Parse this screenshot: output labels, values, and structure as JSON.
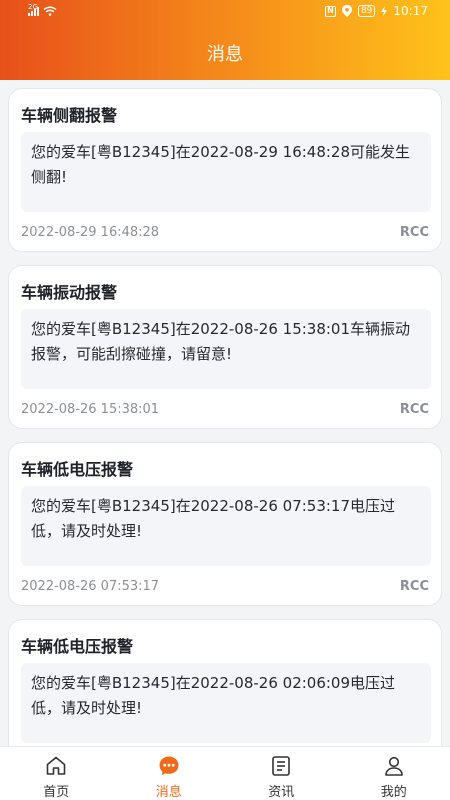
{
  "status_bar": {
    "network": "2G",
    "battery": "89",
    "time": "10:17"
  },
  "header": {
    "title": "消息"
  },
  "messages": [
    {
      "title": "车辆侧翻报警",
      "body": "您的爱车[粤B12345]在2022-08-29 16:48:28可能发生侧翻!",
      "time": "2022-08-29 16:48:28",
      "source": "RCC"
    },
    {
      "title": "车辆振动报警",
      "body": "您的爱车[粤B12345]在2022-08-26 15:38:01车辆振动报警，可能刮擦碰撞，请留意!",
      "time": "2022-08-26 15:38:01",
      "source": "RCC"
    },
    {
      "title": "车辆低电压报警",
      "body": "您的爱车[粤B12345]在2022-08-26 07:53:17电压过低，请及时处理!",
      "time": "2022-08-26 07:53:17",
      "source": "RCC"
    },
    {
      "title": "车辆低电压报警",
      "body": "您的爱车[粤B12345]在2022-08-26 02:06:09电压过低，请及时处理!",
      "time": "",
      "source": ""
    }
  ],
  "tabbar": {
    "active_color": "#f06a1a",
    "items": [
      {
        "label": "首页",
        "icon": "home-icon"
      },
      {
        "label": "消息",
        "icon": "message-icon"
      },
      {
        "label": "资讯",
        "icon": "news-icon"
      },
      {
        "label": "我的",
        "icon": "user-icon"
      }
    ]
  }
}
